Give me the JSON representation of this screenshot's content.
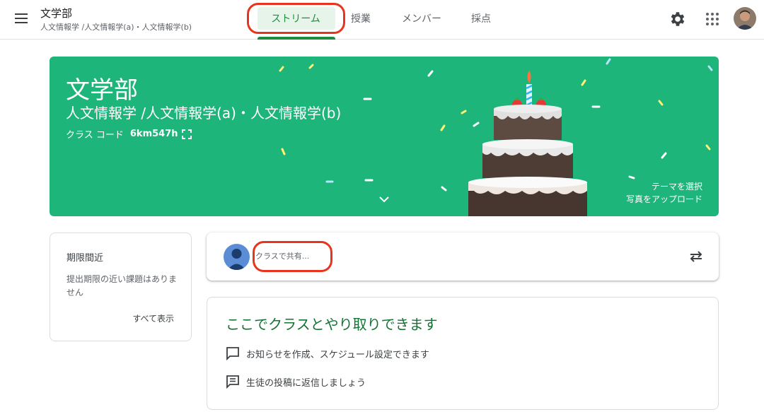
{
  "header": {
    "class_name": "文学部",
    "class_section": "人文情報学 /人文情報学(a)・人文情報学(b)",
    "icons": [
      "menu-icon",
      "gear-icon",
      "apps-icon"
    ]
  },
  "tabs": [
    {
      "label": "ストリーム",
      "active": true
    },
    {
      "label": "授業"
    },
    {
      "label": "メンバー"
    },
    {
      "label": "採点"
    }
  ],
  "banner": {
    "title": "文学部",
    "subtitle": "人文情報学 /人文情報学(a)・人文情報学(b)",
    "class_code_label": "クラス コード",
    "class_code": "6km547h",
    "select_theme": "テーマを選択",
    "upload_photo": "写真をアップロード",
    "color": "#1eb57a"
  },
  "due_soon": {
    "title": "期限間近",
    "empty_text": "提出期限の近い課題はありません",
    "view_all": "すべて表示"
  },
  "share": {
    "placeholder": "クラスで共有..."
  },
  "info": {
    "title": "ここでクラスとやり取りできます",
    "items": [
      {
        "icon": "announcement-icon",
        "text": "お知らせを作成、スケジュール設定できます"
      },
      {
        "icon": "comment-icon",
        "text": "生徒の投稿に返信しましょう"
      }
    ]
  },
  "colors": {
    "accent": "#1e8e3e",
    "highlight": "#e8341c"
  }
}
